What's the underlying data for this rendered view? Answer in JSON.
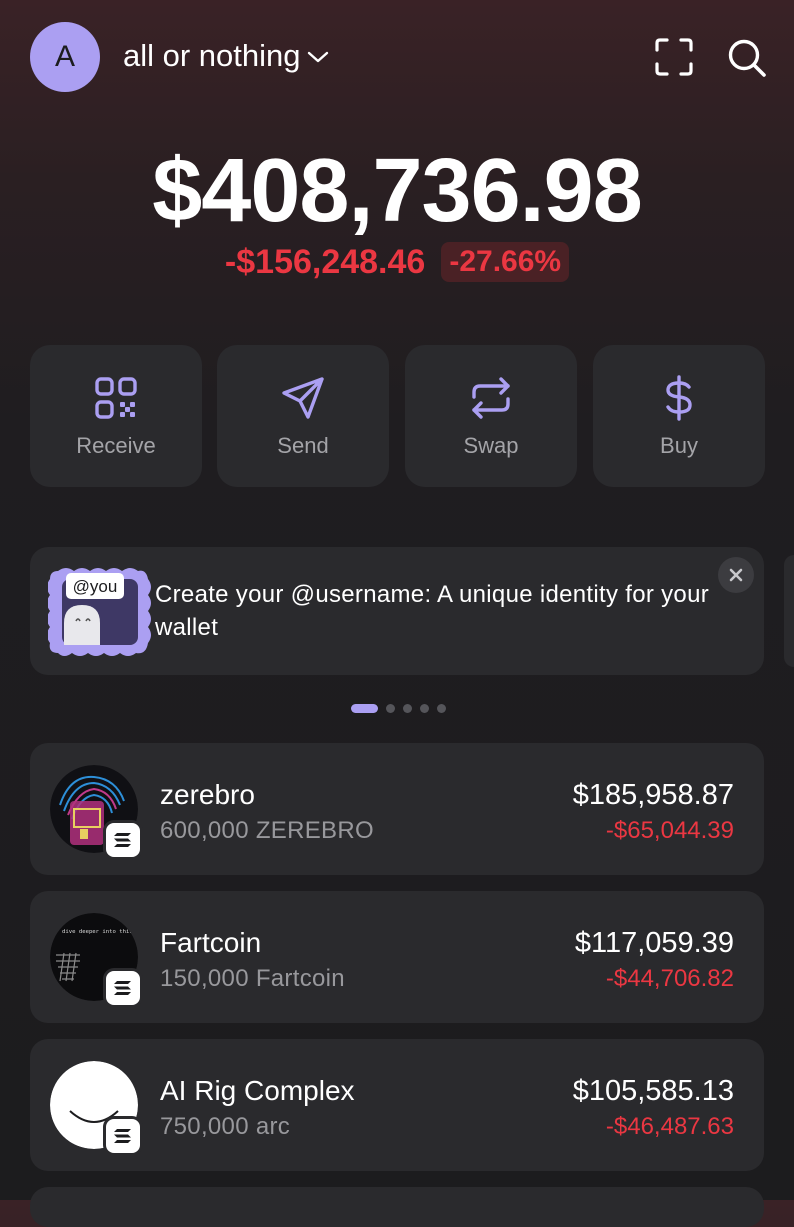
{
  "header": {
    "avatar_letter": "A",
    "account_name": "all or nothing",
    "icons": [
      "chevron-down-icon",
      "scan-icon",
      "search-icon"
    ]
  },
  "balance": {
    "total": "$408,736.98",
    "change_amount": "-$156,248.46",
    "change_percent": "-27.66%"
  },
  "actions": [
    {
      "label": "Receive",
      "icon": "qr-code-icon"
    },
    {
      "label": "Send",
      "icon": "send-icon"
    },
    {
      "label": "Swap",
      "icon": "swap-icon"
    },
    {
      "label": "Buy",
      "icon": "dollar-icon"
    }
  ],
  "banner": {
    "badge": "@you",
    "text": "Create your @username: A unique identity for your wallet",
    "page_count": 5,
    "active_page": 1
  },
  "tokens": [
    {
      "name": "zerebro",
      "amount": "600,000 ZEREBRO",
      "value": "$185,958.87",
      "change": "-$65,044.39",
      "chain_icon": "solana-icon"
    },
    {
      "name": "Fartcoin",
      "amount": "150,000 Fartcoin",
      "value": "$117,059.39",
      "change": "-$44,706.82",
      "chain_icon": "solana-icon",
      "image_text": "dive deeper into this"
    },
    {
      "name": "AI Rig Complex",
      "amount": "750,000 arc",
      "value": "$105,585.13",
      "change": "-$46,487.63",
      "chain_icon": "solana-icon"
    }
  ],
  "colors": {
    "accent": "#ab9ff2",
    "negative": "#eb3742",
    "card": "#2a2a2d",
    "background": "#1c1c1e"
  }
}
